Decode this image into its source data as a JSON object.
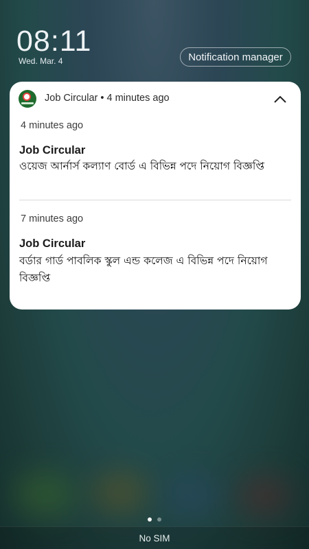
{
  "lockscreen": {
    "time": "08:11",
    "date": "Wed. Mar. 4",
    "notification_manager_label": "Notification manager"
  },
  "notification_group": {
    "app_icon": "job-circular-app-icon",
    "header": "Job Circular • 4 minutes ago",
    "collapse_icon": "chevron-up-icon",
    "items": [
      {
        "time": "4 minutes ago",
        "title": "Job Circular",
        "body": "ওয়েজ আর্নার্স কল্যাণ বোর্ড এ বিভিন্ন পদে নিয়োগ বিজ্ঞপ্তি"
      },
      {
        "time": "7 minutes ago",
        "title": "Job Circular",
        "body": "বর্ডার গার্ড পাবলিক স্কুল এন্ড কলেজ এ বিভিন্ন পদে নিয়োগ বিজ্ঞপ্তি"
      }
    ]
  },
  "pager": {
    "pages": 2,
    "active_index": 0
  },
  "status": {
    "sim": "No SIM"
  }
}
